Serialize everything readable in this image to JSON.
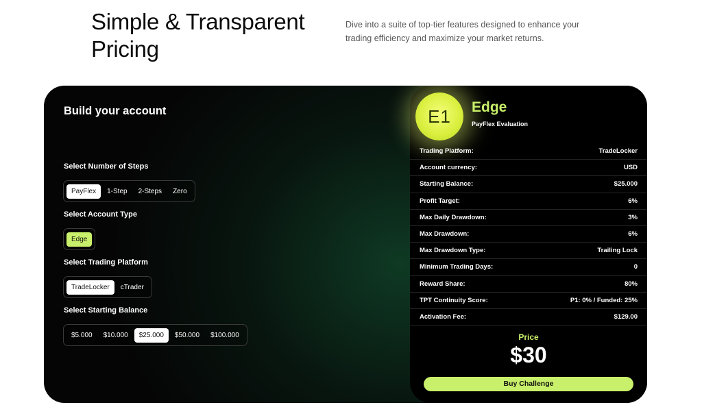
{
  "hero": {
    "title": "Simple & Transparent Pricing",
    "description": "Dive into a suite of top-tier features designed to enhance your trading efficiency and maximize your market returns."
  },
  "builder": {
    "title": "Build your account",
    "steps": {
      "label": "Select Number of Steps",
      "options": [
        "PayFlex",
        "1-Step",
        "2-Steps",
        "Zero"
      ],
      "selected": "PayFlex"
    },
    "account_type": {
      "label": "Select Account Type",
      "options": [
        "Edge"
      ],
      "selected": "Edge"
    },
    "platform": {
      "label": "Select Trading Platform",
      "options": [
        "TradeLocker",
        "cTrader"
      ],
      "selected": "TradeLocker"
    },
    "balance": {
      "label": "Select Starting Balance",
      "options": [
        "$5.000",
        "$10.000",
        "$25.000",
        "$50.000",
        "$100.000"
      ],
      "selected": "$25.000"
    }
  },
  "plan": {
    "badge": "E1",
    "name": "Edge",
    "subtitle": "PayFlex Evaluation",
    "specs": [
      {
        "label": "Trading Platform:",
        "value": "TradeLocker"
      },
      {
        "label": "Account currency:",
        "value": "USD"
      },
      {
        "label": "Starting Balance:",
        "value": "$25.000"
      },
      {
        "label": "Profit Target:",
        "value": "6%"
      },
      {
        "label": "Max Daily Drawdown:",
        "value": "3%"
      },
      {
        "label": "Max Drawdown:",
        "value": "6%"
      },
      {
        "label": "Max Drawdown Type:",
        "value": "Trailing Lock"
      },
      {
        "label": "Minimum Trading Days:",
        "value": "0"
      },
      {
        "label": "Reward Share:",
        "value": "80%"
      },
      {
        "label": "TPT Continuity Score:",
        "value": "P1: 0% / Funded: 25%"
      },
      {
        "label": "Activation Fee:",
        "value": "$129.00"
      }
    ],
    "price_label": "Price",
    "price": "$30",
    "buy_label": "Buy Challenge"
  },
  "colors": {
    "accent": "#c9f06a",
    "panel": "#050505",
    "panel_glow": "#0f3a24"
  }
}
